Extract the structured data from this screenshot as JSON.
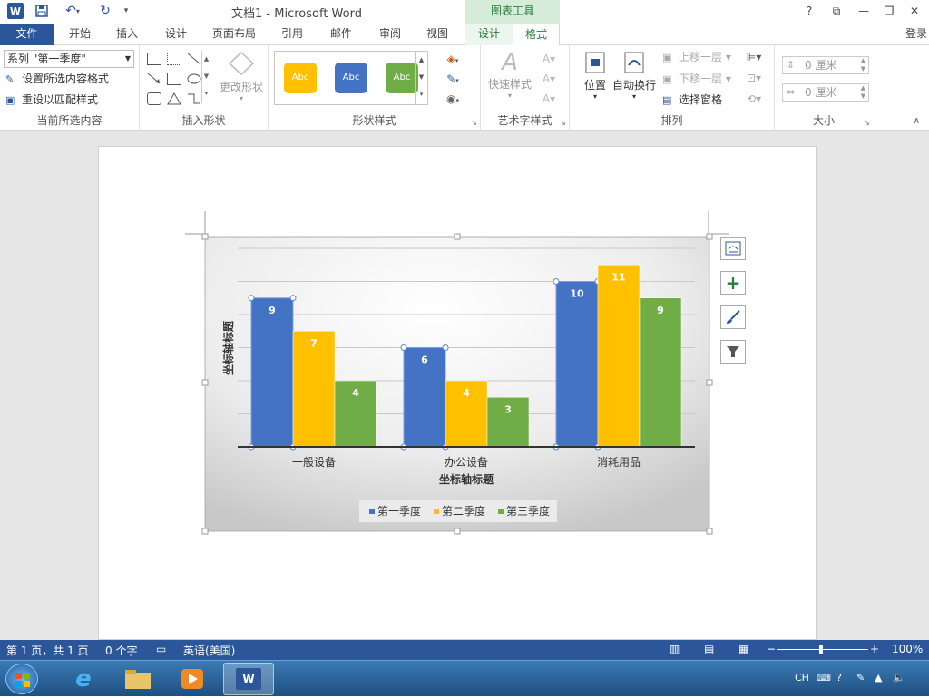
{
  "titlebar": {
    "title": "文档1 - Microsoft Word",
    "context_tab_group": "图表工具",
    "help": "?",
    "buttons": {
      "ribbon_options": "⧉",
      "minimize": "—",
      "restore": "❐",
      "close": "✕"
    }
  },
  "tabs": {
    "file": "文件",
    "items": [
      "开始",
      "插入",
      "设计",
      "页面布局",
      "引用",
      "邮件",
      "审阅",
      "视图"
    ],
    "context_items": [
      "设计",
      "格式"
    ],
    "active": "格式",
    "login": "登录"
  },
  "ribbon": {
    "current_selection": {
      "select_value": "系列 \"第一季度\"",
      "format_selection": "设置所选内容格式",
      "reset_style": "重设以匹配样式",
      "label": "当前所选内容"
    },
    "insert_shapes": {
      "change_shape": "更改形状",
      "label": "插入形状"
    },
    "shape_styles": {
      "samples": [
        {
          "text": "Abc",
          "color": "#ffc000"
        },
        {
          "text": "Abc",
          "color": "#4472c4"
        },
        {
          "text": "Abc",
          "color": "#70ad47"
        }
      ],
      "label": "形状样式"
    },
    "wordart": {
      "quick_styles": "快速样式",
      "label": "艺术字样式"
    },
    "arrange": {
      "position": "位置",
      "wrap_text": "自动换行",
      "bring_forward": "上移一层",
      "send_backward": "下移一层",
      "selection_pane": "选择窗格",
      "label": "排列"
    },
    "size": {
      "height": "0 厘米",
      "width": "0 厘米",
      "label": "大小"
    }
  },
  "chart_data": {
    "type": "bar",
    "categories": [
      "一般设备",
      "办公设备",
      "消耗用品"
    ],
    "series": [
      {
        "name": "第一季度",
        "values": [
          9,
          6,
          10
        ],
        "color": "#4472c4"
      },
      {
        "name": "第二季度",
        "values": [
          7,
          4,
          11
        ],
        "color": "#ffc000"
      },
      {
        "name": "第三季度",
        "values": [
          4,
          3,
          9
        ],
        "color": "#70ad47"
      }
    ],
    "xlabel": "坐标轴标题",
    "ylabel": "坐标轴标题",
    "ylim": [
      0,
      12
    ],
    "grid": true,
    "legend": "bottom",
    "selected_series": "第一季度"
  },
  "statusbar": {
    "page": "第 1 页，共 1 页",
    "words": "0 个字",
    "language": "英语(美国)",
    "zoom": "100%"
  },
  "taskbar": {
    "tray_lang": "CH"
  }
}
